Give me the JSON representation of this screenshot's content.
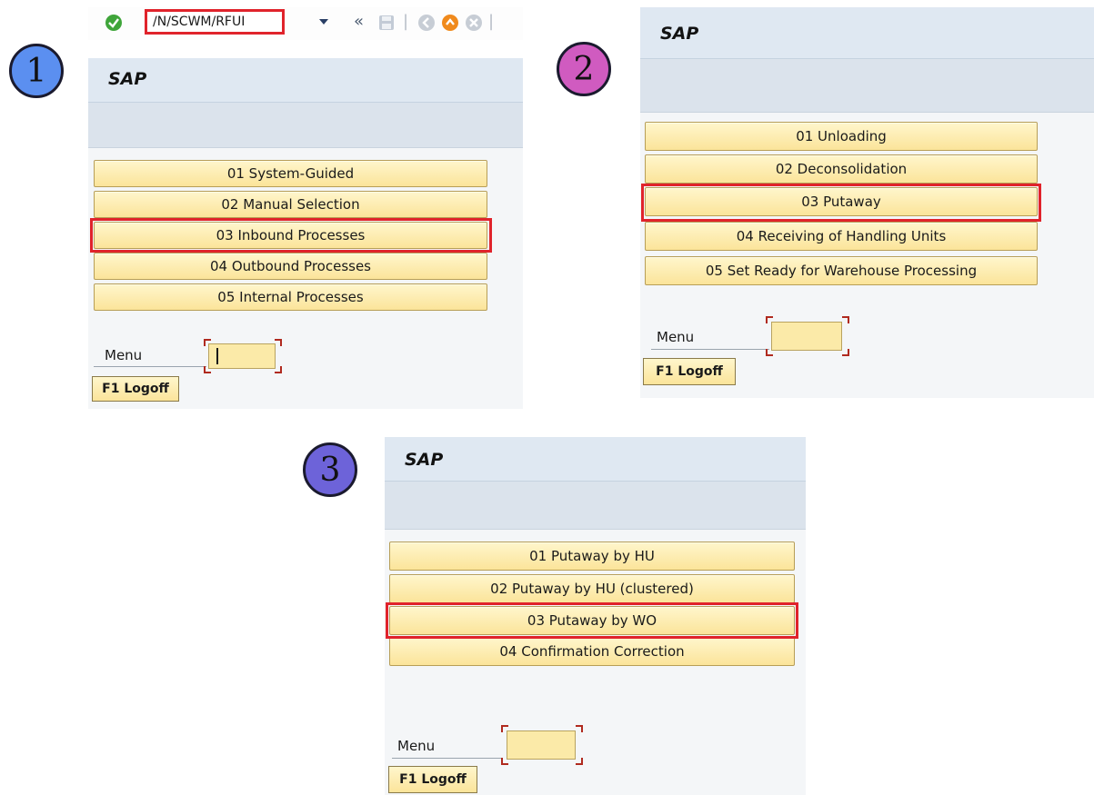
{
  "step_badges": [
    "1",
    "2",
    "3"
  ],
  "toolbar": {
    "command_value": "/N/SCWM/RFUI",
    "icons": [
      "check-icon",
      "dropdown-icon",
      "back-double-icon",
      "save-icon",
      "back-icon",
      "exit-icon",
      "cancel-icon"
    ]
  },
  "panel1": {
    "title": "SAP",
    "buttons": [
      "01 System-Guided",
      "02 Manual Selection",
      "03 Inbound Processes",
      "04 Outbound Processes",
      "05 Internal Processes"
    ],
    "highlighted_index": 2,
    "menu_label": "Menu",
    "logoff_label": "F1 Logoff"
  },
  "panel2": {
    "title": "SAP",
    "buttons": [
      "01 Unloading",
      "02 Deconsolidation",
      "03 Putaway",
      "04 Receiving of Handling Units",
      "05 Set Ready for Warehouse Processing"
    ],
    "highlighted_index": 2,
    "menu_label": "Menu",
    "logoff_label": "F1 Logoff"
  },
  "panel3": {
    "title": "SAP",
    "buttons": [
      "01 Putaway by HU",
      "02 Putaway by HU (clustered)",
      "03 Putaway by WO",
      "04 Confirmation Correction"
    ],
    "highlighted_index": 2,
    "menu_label": "Menu",
    "logoff_label": "F1 Logoff"
  },
  "colors": {
    "highlight": "#e0232b",
    "button_fill": "#fbe49a",
    "title_bar": "#dfe8f2"
  }
}
